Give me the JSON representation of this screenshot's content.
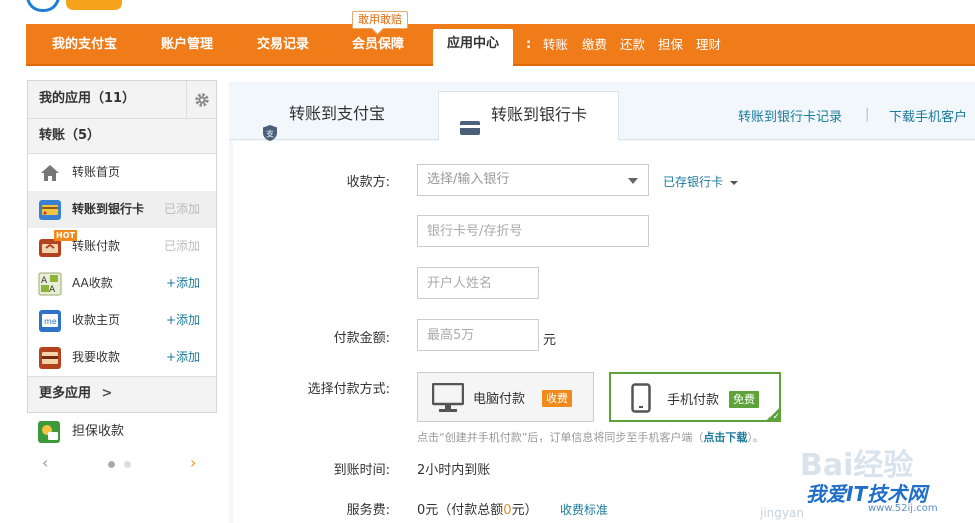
{
  "colors": {
    "brand_orange": "#ef7b19",
    "link_blue": "#1a7a9c",
    "accent_green": "#5ea33a",
    "fee_orange": "#f08a1d"
  },
  "nav": {
    "items": [
      "我的支付宝",
      "账户管理",
      "交易记录",
      "会员保障"
    ],
    "active": "应用中心",
    "bubble": "敢用敢赔",
    "separator": ":",
    "quick_links": [
      "转账",
      "缴费",
      "还款",
      "担保",
      "理财"
    ]
  },
  "sidebar": {
    "header": "我的应用（11）",
    "gear_icon": "gear-icon",
    "group": "转账（5）",
    "items": [
      {
        "label": "转账首页",
        "action": "",
        "icon": "home-icon"
      },
      {
        "label": "转账到银行卡",
        "action": "已添加",
        "icon": "bank-card-icon"
      },
      {
        "label": "转账付款",
        "action": "已添加",
        "icon": "transfer-pay-icon",
        "badge": "HOT"
      },
      {
        "label": "AA收款",
        "action": "+添加",
        "icon": "aa-collect-icon"
      },
      {
        "label": "收款主页",
        "action": "+添加",
        "icon": "collect-home-icon"
      },
      {
        "label": "我要收款",
        "action": "+添加",
        "icon": "want-collect-icon"
      }
    ],
    "more": "更多应用",
    "more_arrow": ">",
    "extra_app": "担保收款",
    "pager_prev": "‹",
    "pager_next": "›"
  },
  "tabs": {
    "tab1": "转账到支付宝",
    "tab2": "转账到银行卡",
    "link1": "转账到银行卡记录",
    "divider": "|",
    "link2": "下载手机客户"
  },
  "form": {
    "payee_label": "收款方:",
    "bank_placeholder": "选择/输入银行",
    "saved_cards": "已存银行卡",
    "card_placeholder": "银行卡号/存折号",
    "name_placeholder": "开户人姓名",
    "amount_label": "付款金额:",
    "amount_placeholder": "最高5万",
    "amount_unit": "元",
    "method_label": "选择付款方式:",
    "method_pc": "电脑付款",
    "method_pc_badge": "收费",
    "method_mobile": "手机付款",
    "method_mobile_badge": "免费",
    "hint_text": "点击“创建并手机付款”后，订单信息将同步至手机客户端（",
    "hint_link": "点击下载",
    "hint_end": "）。",
    "arrival_label": "到账时间:",
    "arrival_value": "2小时内到账",
    "fee_label": "服务费:",
    "fee_value_pre": "0元（付款总额",
    "fee_value_mid": "0",
    "fee_value_post": "元）",
    "fee_link": "收费标准"
  },
  "watermark": {
    "baidu": "Bai经验",
    "site": "我爱IT技术网",
    "domain": "www.52ij.com",
    "jingyan": "jingyan"
  }
}
